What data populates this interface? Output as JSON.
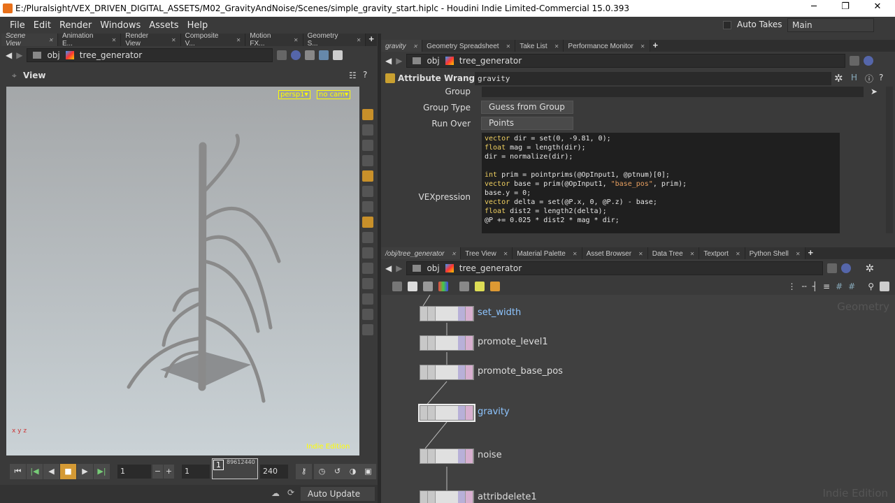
{
  "window": {
    "title": "E:/Pluralsight/VEX_DRIVEN_DIGITAL_ASSETS/M02_GravityAndNoise/Scenes/simple_gravity_start.hiplc - Houdini Indie Limited-Commercial 15.0.393",
    "minimize": "─",
    "restore": "❐",
    "close": "✕"
  },
  "menu": [
    "File",
    "Edit",
    "Render",
    "Windows",
    "Assets",
    "Help"
  ],
  "top_right": {
    "auto_takes": "Auto Takes",
    "desktop": "Main"
  },
  "left_tabs": [
    "Scene View",
    "Animation E...",
    "Render View",
    "Composite V...",
    "Motion FX...",
    "Geometry S..."
  ],
  "path": {
    "root": "obj",
    "node": "tree_generator"
  },
  "viewer": {
    "title": "View",
    "camera": "persp1▾",
    "cam_menu": "no cam▾",
    "watermark": "Indie Edition",
    "axes": "x y z"
  },
  "playbar": {
    "frame": "1",
    "start": "1",
    "end": "240",
    "ruler_frame": "1",
    "ruler_ticks": "89612440"
  },
  "status": {
    "update_mode": "Auto Update"
  },
  "param_tabs": [
    "gravity",
    "Geometry Spreadsheet",
    "Take List",
    "Performance Monitor"
  ],
  "node_header": {
    "type": "Attribute Wrangle",
    "name": "gravity"
  },
  "params": {
    "group_label": "Group",
    "group_value": "",
    "group_type_label": "Group Type",
    "group_type": "Guess from Group",
    "run_over_label": "Run Over",
    "run_over": "Points",
    "vex_label": "VEXpression"
  },
  "code": [
    "vector dir = set(0, -9.81, 0);",
    "float mag = length(dir);",
    "dir = normalize(dir);",
    "",
    "int prim = pointprims(@OpInput1, @ptnum)[0];",
    "vector base = prim(@OpInput1, \"base_pos\", prim);",
    "base.y = 0;",
    "vector delta = set(@P.x, 0, @P.z) - base;",
    "float dist2 = length2(delta);",
    "@P += 0.025 * dist2 * mag * dir;"
  ],
  "net_tabs": [
    "/obj/tree_generator",
    "Tree View",
    "Material Palette",
    "Asset Browser",
    "Data Tree",
    "Textport",
    "Python Shell"
  ],
  "network": {
    "context": "Geometry",
    "watermark": "Indie Edition",
    "nodes": [
      {
        "name": "set_width",
        "selected": false
      },
      {
        "name": "promote_level1",
        "selected": false
      },
      {
        "name": "promote_base_pos",
        "selected": false
      },
      {
        "name": "gravity",
        "selected": true
      },
      {
        "name": "noise",
        "selected": false
      },
      {
        "name": "attribdelete1",
        "selected": false
      }
    ]
  },
  "colors": {
    "accent": "#e8a33a",
    "selected_node": "#8ec5ff",
    "viewport_tag": "#ffff00"
  }
}
